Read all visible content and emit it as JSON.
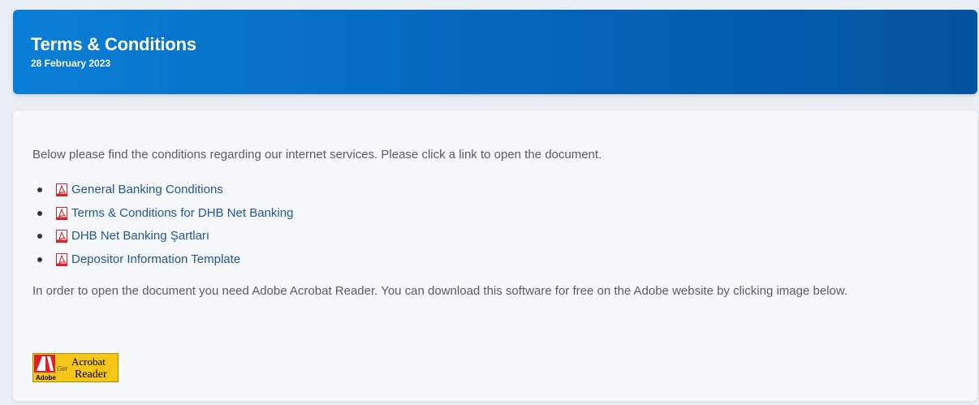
{
  "header": {
    "title": "Terms & Conditions",
    "date": "28 February 2023"
  },
  "content": {
    "intro": "Below please find the conditions regarding our internet services. Please click a link to open the document.",
    "documents": [
      {
        "label": "General Banking Conditions"
      },
      {
        "label": "Terms & Conditions for DHB Net Banking"
      },
      {
        "label": "DHB Net Banking Şartları"
      },
      {
        "label": "Depositor Information Template"
      }
    ],
    "note": "In order to open the document you need Adobe Acrobat Reader. You can download this software for free on the Adobe website by clicking image below.",
    "adobe_badge": {
      "brand": "Adobe",
      "get": "Get",
      "line1": "Acrobat",
      "line2": "Reader"
    }
  },
  "colors": {
    "header_start": "#0a7fd6",
    "header_end": "#03539f",
    "link": "#1f5796",
    "text": "#5b5b5b",
    "pdf_red": "#d8232a",
    "badge_yellow": "#f5c518"
  },
  "icons": {
    "document": "pdf-file-icon",
    "badge": "adobe-acrobat-reader-icon"
  }
}
